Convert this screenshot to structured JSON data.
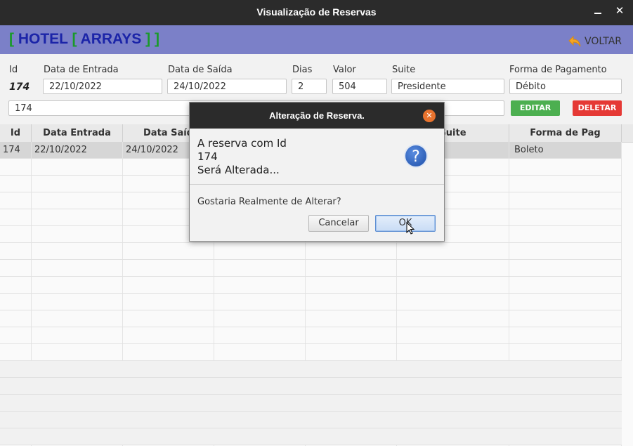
{
  "window": {
    "title": "Visualização de Reservas"
  },
  "header": {
    "logo": [
      "[",
      "HOTEL",
      "[",
      "ARRAYS",
      "]",
      "]"
    ],
    "back_label": "VOLTAR"
  },
  "form": {
    "labels": {
      "id": "Id",
      "entrada": "Data de Entrada",
      "saida": "Data de Saída",
      "dias": "Dias",
      "valor": "Valor",
      "suite": "Suite",
      "pagamento": "Forma de Pagamento"
    },
    "values": {
      "id": "174",
      "entrada": "22/10/2022",
      "saida": "24/10/2022",
      "dias": "2",
      "valor": "504",
      "suite": "Presidente",
      "pagamento": "Débito",
      "search": "174"
    },
    "buttons": {
      "edit": "EDITAR",
      "delete": "DELETAR"
    },
    "colors": {
      "edit": "#4caf50",
      "delete": "#e53935"
    }
  },
  "table": {
    "columns": [
      "Id",
      "Data Entrada",
      "Data Saíd",
      "",
      "",
      "Suite",
      "Forma de Pag"
    ],
    "rows": [
      [
        "174",
        "22/10/2022",
        "24/10/2022",
        "",
        "",
        "e",
        "Boleto"
      ]
    ]
  },
  "dialog": {
    "title": "Alteração de Reserva.",
    "message_lines": [
      "A reserva com Id",
      "174",
      "Será Alterada..."
    ],
    "question": "Gostaria Realmente de Alterar?",
    "cancel": "Cancelar",
    "ok": "OK"
  }
}
